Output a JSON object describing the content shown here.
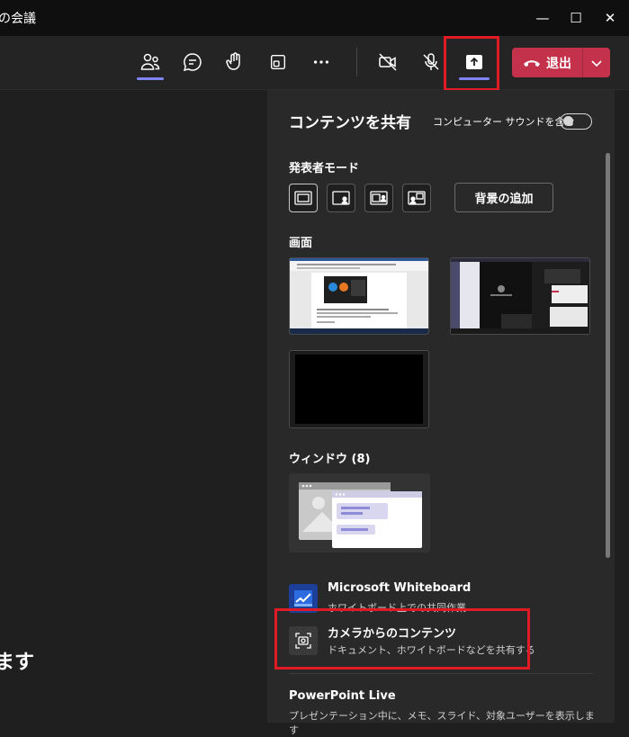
{
  "window": {
    "title": "の会議",
    "minimize_glyph": "—",
    "maximize_glyph": "☐",
    "close_glyph": "✕"
  },
  "toolbar": {
    "buttons": [
      {
        "icon": "people-icon"
      },
      {
        "icon": "chat-icon"
      },
      {
        "icon": "raise-hand-icon"
      },
      {
        "icon": "rooms-icon"
      },
      {
        "icon": "more-icon"
      },
      {
        "icon": "camera-off-icon"
      },
      {
        "icon": "mic-off-icon"
      },
      {
        "icon": "share-icon"
      }
    ],
    "leave_label": "退出"
  },
  "stage": {
    "partial_text": "ます"
  },
  "share_panel": {
    "title": "コンテンツを共有",
    "include_sound_label": "コンピューター サウンドを含む",
    "include_sound_on": false,
    "presenter_mode": {
      "label": "発表者モード",
      "modes": [
        "content-only",
        "standout",
        "side-by-side",
        "reporter"
      ],
      "add_background_label": "背景の追加"
    },
    "screen": {
      "label": "画面",
      "count": 3
    },
    "window": {
      "label": "ウィンドウ (8)"
    },
    "apps": [
      {
        "title": "Microsoft Whiteboard",
        "desc": "ホワイトボード上での共同作業",
        "icon": "whiteboard-icon"
      },
      {
        "title": "カメラからのコンテンツ",
        "desc": "ドキュメント、ホワイトボードなどを共有する",
        "icon": "camera-content-icon"
      },
      {
        "title": "PowerPoint Live",
        "desc": "プレゼンテーション中に、メモ、スライド、対象ユーザーを表示します",
        "icon": "powerpoint-icon"
      }
    ]
  },
  "colors": {
    "leave": "#c4314b",
    "accent": "#7f85f5",
    "highlight_box": "#e01b24",
    "panel_bg": "#292929"
  }
}
